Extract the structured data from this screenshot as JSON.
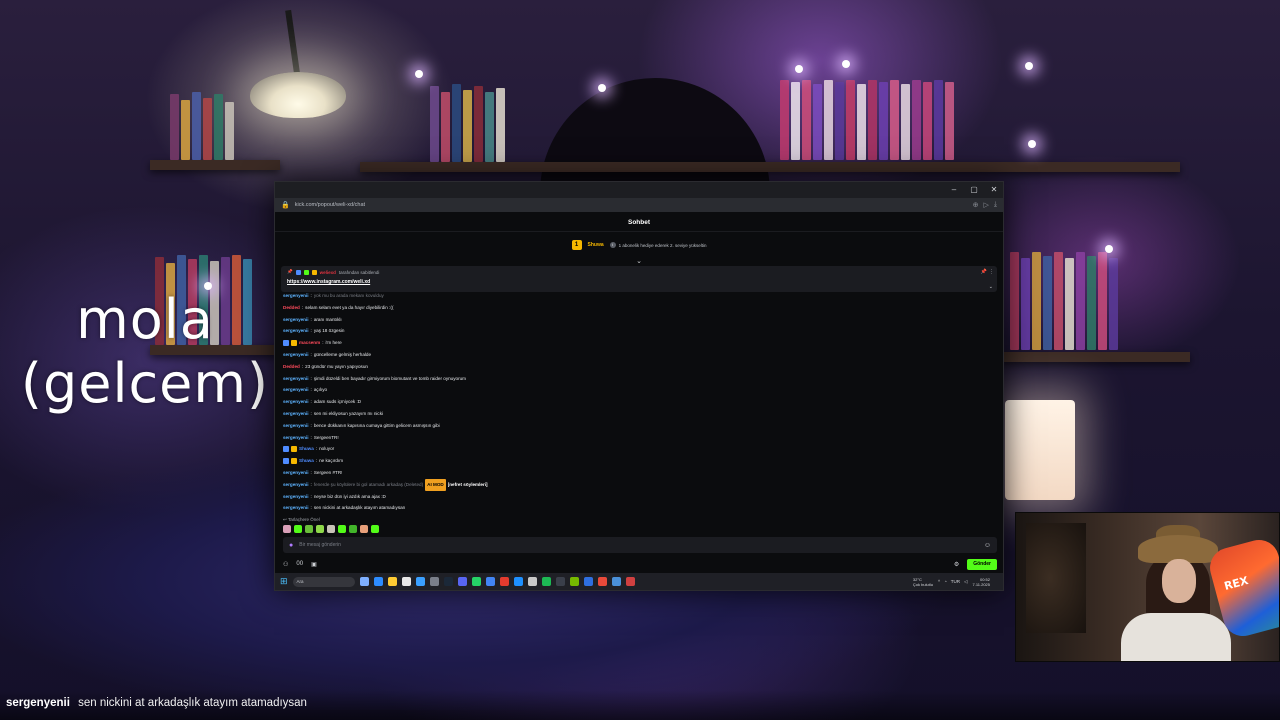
{
  "overlay": {
    "line1": "mola",
    "line2": "(gelcem)"
  },
  "browser": {
    "url": "kick.com/popout/weli-xd/chat",
    "controls": {
      "minimize": "–",
      "restore": "▢",
      "close": "✕"
    }
  },
  "chat": {
    "header": "Sohbet",
    "sub_goal": {
      "badge_number": "1",
      "name": "Shuwa",
      "info_text": "1 abonelik hediye ederek 2. seviye yükseltin"
    },
    "pinned": {
      "author": "weliexd",
      "by_text": "tarafından sabitlendi",
      "link": "https://www.instagram.com/weli.xd"
    },
    "messages": [
      {
        "user": "sergenyenii",
        "user_color": "serg",
        "text": "yok mu bu arada mekanı kovulduy",
        "faded": true
      },
      {
        "user": "Dedded",
        "user_color": "red",
        "text": "selam selam evet ya da hayır diyebilirdin :(("
      },
      {
        "user": "sergenyenii",
        "user_color": "serg",
        "text": "aranı mantıklı"
      },
      {
        "user": "sergenyenii",
        "user_color": "serg",
        "text": "yaş 18 özgesin"
      },
      {
        "user": "macsenm",
        "user_color": "red",
        "text": "i'm here",
        "badges": true
      },
      {
        "user": "sergenyenii",
        "user_color": "serg",
        "text": "güncelleme gelmiş herhalde"
      },
      {
        "user": "Dedded",
        "user_color": "red",
        "text": "23 gündür mu yayın yapıyosun"
      },
      {
        "user": "sergenyenii",
        "user_color": "serg",
        "text": "şimdi düzeldi ben bayadır girmiyorum biomutant ve tomb raider oynuyorum"
      },
      {
        "user": "sergenyenii",
        "user_color": "serg",
        "text": "açılıyo"
      },
      {
        "user": "sergenyenii",
        "user_color": "serg",
        "text": "adam suds içmiycek :D"
      },
      {
        "user": "sergenyenii",
        "user_color": "serg",
        "text": "sen mi ekliyosun yazayım mı nicki"
      },
      {
        "user": "sergenyenii",
        "user_color": "serg",
        "text": "bence dükkanın kapısına cumaya gittim gelicem asmışsın gibi"
      },
      {
        "user": "sergenyenii",
        "user_color": "serg",
        "text": "SergeenTR!"
      },
      {
        "user": "Shuwa",
        "user_color": "blue",
        "text": "noluyor",
        "badges": true
      },
      {
        "user": "Shuwa",
        "user_color": "blue",
        "text": "ne kaçırdım",
        "badges": true
      },
      {
        "user": "sergenyenii",
        "user_color": "serg",
        "text": "Sergeen #TR!"
      },
      {
        "user": "sergenyenii",
        "user_color": "serg",
        "text": "fenerde şu köylülere bi gol atamadı arkadaş (Deleted)",
        "faded": true,
        "tag": "AI MOD",
        "tag2": "[nefret söylemleri]"
      },
      {
        "user": "sergenyenii",
        "user_color": "serg",
        "text": "neyse biz dün iyi azdık ama ajax :D"
      },
      {
        "user": "sergenyenii",
        "user_color": "serg",
        "text": "sen nickini at arkadaşlık atayım atamadıysan"
      }
    ],
    "reply_hint": "Tarlaçhere Önel",
    "input_placeholder": "Bir mesaj gönderin",
    "send_label": "Gönder",
    "footer_count": "00"
  },
  "taskbar": {
    "search_label": "Ara",
    "weather_temp": "32°C",
    "weather_desc": "Çok bulutlu",
    "lang": "TUR",
    "time": "00:52",
    "date": "7.11.2025"
  },
  "webcam": {
    "blaster_text": "REX"
  },
  "bottom_chat": {
    "user": "sergenyenii",
    "text": "sen nickini at arkadaşlık atayım atamadıysan"
  },
  "colors": {
    "kick_green": "#53fc18",
    "user_blue": "#5eb3ff",
    "user_red": "#ff4b5c",
    "goal_gold": "#f6b800"
  }
}
